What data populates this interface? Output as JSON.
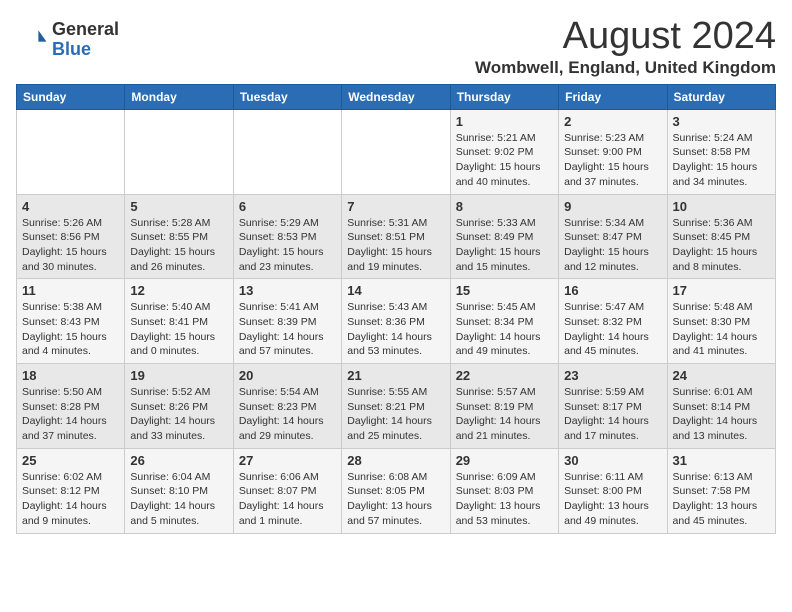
{
  "header": {
    "logo_line1": "General",
    "logo_line2": "Blue",
    "title": "August 2024",
    "subtitle": "Wombwell, England, United Kingdom"
  },
  "days_of_week": [
    "Sunday",
    "Monday",
    "Tuesday",
    "Wednesday",
    "Thursday",
    "Friday",
    "Saturday"
  ],
  "weeks": [
    [
      {
        "day": "",
        "info": ""
      },
      {
        "day": "",
        "info": ""
      },
      {
        "day": "",
        "info": ""
      },
      {
        "day": "",
        "info": ""
      },
      {
        "day": "1",
        "info": "Sunrise: 5:21 AM\nSunset: 9:02 PM\nDaylight: 15 hours\nand 40 minutes."
      },
      {
        "day": "2",
        "info": "Sunrise: 5:23 AM\nSunset: 9:00 PM\nDaylight: 15 hours\nand 37 minutes."
      },
      {
        "day": "3",
        "info": "Sunrise: 5:24 AM\nSunset: 8:58 PM\nDaylight: 15 hours\nand 34 minutes."
      }
    ],
    [
      {
        "day": "4",
        "info": "Sunrise: 5:26 AM\nSunset: 8:56 PM\nDaylight: 15 hours\nand 30 minutes."
      },
      {
        "day": "5",
        "info": "Sunrise: 5:28 AM\nSunset: 8:55 PM\nDaylight: 15 hours\nand 26 minutes."
      },
      {
        "day": "6",
        "info": "Sunrise: 5:29 AM\nSunset: 8:53 PM\nDaylight: 15 hours\nand 23 minutes."
      },
      {
        "day": "7",
        "info": "Sunrise: 5:31 AM\nSunset: 8:51 PM\nDaylight: 15 hours\nand 19 minutes."
      },
      {
        "day": "8",
        "info": "Sunrise: 5:33 AM\nSunset: 8:49 PM\nDaylight: 15 hours\nand 15 minutes."
      },
      {
        "day": "9",
        "info": "Sunrise: 5:34 AM\nSunset: 8:47 PM\nDaylight: 15 hours\nand 12 minutes."
      },
      {
        "day": "10",
        "info": "Sunrise: 5:36 AM\nSunset: 8:45 PM\nDaylight: 15 hours\nand 8 minutes."
      }
    ],
    [
      {
        "day": "11",
        "info": "Sunrise: 5:38 AM\nSunset: 8:43 PM\nDaylight: 15 hours\nand 4 minutes."
      },
      {
        "day": "12",
        "info": "Sunrise: 5:40 AM\nSunset: 8:41 PM\nDaylight: 15 hours\nand 0 minutes."
      },
      {
        "day": "13",
        "info": "Sunrise: 5:41 AM\nSunset: 8:39 PM\nDaylight: 14 hours\nand 57 minutes."
      },
      {
        "day": "14",
        "info": "Sunrise: 5:43 AM\nSunset: 8:36 PM\nDaylight: 14 hours\nand 53 minutes."
      },
      {
        "day": "15",
        "info": "Sunrise: 5:45 AM\nSunset: 8:34 PM\nDaylight: 14 hours\nand 49 minutes."
      },
      {
        "day": "16",
        "info": "Sunrise: 5:47 AM\nSunset: 8:32 PM\nDaylight: 14 hours\nand 45 minutes."
      },
      {
        "day": "17",
        "info": "Sunrise: 5:48 AM\nSunset: 8:30 PM\nDaylight: 14 hours\nand 41 minutes."
      }
    ],
    [
      {
        "day": "18",
        "info": "Sunrise: 5:50 AM\nSunset: 8:28 PM\nDaylight: 14 hours\nand 37 minutes."
      },
      {
        "day": "19",
        "info": "Sunrise: 5:52 AM\nSunset: 8:26 PM\nDaylight: 14 hours\nand 33 minutes."
      },
      {
        "day": "20",
        "info": "Sunrise: 5:54 AM\nSunset: 8:23 PM\nDaylight: 14 hours\nand 29 minutes."
      },
      {
        "day": "21",
        "info": "Sunrise: 5:55 AM\nSunset: 8:21 PM\nDaylight: 14 hours\nand 25 minutes."
      },
      {
        "day": "22",
        "info": "Sunrise: 5:57 AM\nSunset: 8:19 PM\nDaylight: 14 hours\nand 21 minutes."
      },
      {
        "day": "23",
        "info": "Sunrise: 5:59 AM\nSunset: 8:17 PM\nDaylight: 14 hours\nand 17 minutes."
      },
      {
        "day": "24",
        "info": "Sunrise: 6:01 AM\nSunset: 8:14 PM\nDaylight: 14 hours\nand 13 minutes."
      }
    ],
    [
      {
        "day": "25",
        "info": "Sunrise: 6:02 AM\nSunset: 8:12 PM\nDaylight: 14 hours\nand 9 minutes."
      },
      {
        "day": "26",
        "info": "Sunrise: 6:04 AM\nSunset: 8:10 PM\nDaylight: 14 hours\nand 5 minutes."
      },
      {
        "day": "27",
        "info": "Sunrise: 6:06 AM\nSunset: 8:07 PM\nDaylight: 14 hours\nand 1 minute."
      },
      {
        "day": "28",
        "info": "Sunrise: 6:08 AM\nSunset: 8:05 PM\nDaylight: 13 hours\nand 57 minutes."
      },
      {
        "day": "29",
        "info": "Sunrise: 6:09 AM\nSunset: 8:03 PM\nDaylight: 13 hours\nand 53 minutes."
      },
      {
        "day": "30",
        "info": "Sunrise: 6:11 AM\nSunset: 8:00 PM\nDaylight: 13 hours\nand 49 minutes."
      },
      {
        "day": "31",
        "info": "Sunrise: 6:13 AM\nSunset: 7:58 PM\nDaylight: 13 hours\nand 45 minutes."
      }
    ]
  ]
}
